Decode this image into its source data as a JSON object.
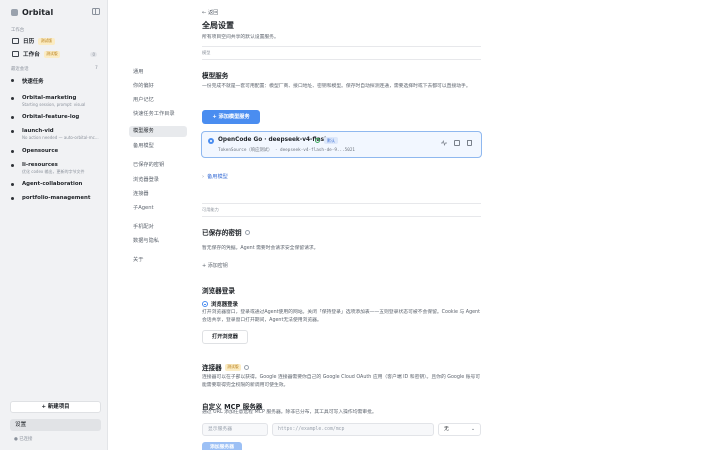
{
  "app": {
    "name": "Orbital"
  },
  "sidebar": {
    "workspace_label": "工作台",
    "workspace_items": [
      {
        "label": "日历",
        "badge": "测试版",
        "count": ""
      },
      {
        "label": "工作台",
        "badge": "测试版",
        "count": "0"
      }
    ],
    "sessions_label": "最近会话",
    "sessions_count": "7",
    "sessions": [
      {
        "title": "快速任务",
        "sub": ""
      },
      {
        "title": "Orbital-marketing",
        "sub": "Starting session, prompt: visual"
      },
      {
        "title": "Orbital-feature-log",
        "sub": ""
      },
      {
        "title": "launch-vid",
        "sub": "No action needed — auto-orbital-mc..."
      },
      {
        "title": "Opensource",
        "sub": ""
      },
      {
        "title": "Ii-resources",
        "sub": "优化 codex 输出，更新的字节文件"
      },
      {
        "title": "Agent-collaboration",
        "sub": ""
      },
      {
        "title": "portfolio-management",
        "sub": ""
      }
    ],
    "new_project": "+ 新建项目",
    "settings": "设置",
    "connected": "● 已连接"
  },
  "header": {
    "back": "← 返回",
    "title": "全局设置",
    "desc": "所有项目空间共享的默认设置服务。"
  },
  "nav": {
    "items": [
      "通用",
      "你的偏好",
      "用户记忆",
      "快速任务工作目录",
      "模型服务",
      "备用模型",
      "已保存的密钥",
      "浏览器登录",
      "连接器",
      "子Agent",
      "手机配对",
      "数据与隐私",
      "关于"
    ],
    "active_index": 4
  },
  "content": {
    "group_model": "模型",
    "model_services": {
      "title": "模型服务",
      "desc": "一份完成不就是一套可用配置：模型厂商、接口地址、密钥和模型。保存时自动探测连通，需要选择时或下去都可以直接动手。",
      "add_button": "+ 添加模型服务",
      "provider": {
        "name": "OpenCode Go · deepseek-v4-flash",
        "badge": "默认",
        "meta": "TokenSource（响应测试） · deepseek-v4-flash-de-9...5021"
      },
      "backup_link": "备用模型"
    },
    "group_capabilities": "可用能力",
    "saved_keys": {
      "title": "已保存的密钥",
      "desc": "暂无保存的凭据。Agent 需要时会请求安全保留请求。",
      "add_link": "+ 添加密钥"
    },
    "browser_login": {
      "title": "浏览器登录",
      "sub_title": "浏览器登录",
      "desc": "打开浏览器窗口，登录或通过Agent使用的网站。关闭「保持登录」选项添加表——五则登录状态可被不会保留。Cookie 与 Agent会话共享，登录窗口打开期间，Agent无法使用浏览器。",
      "button": "打开浏览器"
    },
    "connectors": {
      "title": "连接器",
      "badge": "测试版",
      "desc": "连接器可以在子部以获得。Google 连接器需要你自己的 Google Cloud OAuth 应用（客户端 ID 和密钥）。且你的 Google 账号可能需要取得完全权限的新调用可使生效。"
    },
    "mcp": {
      "title": "自定义 MCP 服务器",
      "desc": "通过 URL 添加任意远程 MCP 服务器。除非已分布，其工具可写入操作均需审批。",
      "name_placeholder": "显示服务器",
      "url_placeholder": "https://example.com/mcp",
      "auth_option": "无",
      "add_button": "添加服务器"
    }
  },
  "colors": {
    "accent": "#4a8df0",
    "sidebar_bg": "#f1f2f4",
    "beta_badge": "#fbecc4"
  }
}
